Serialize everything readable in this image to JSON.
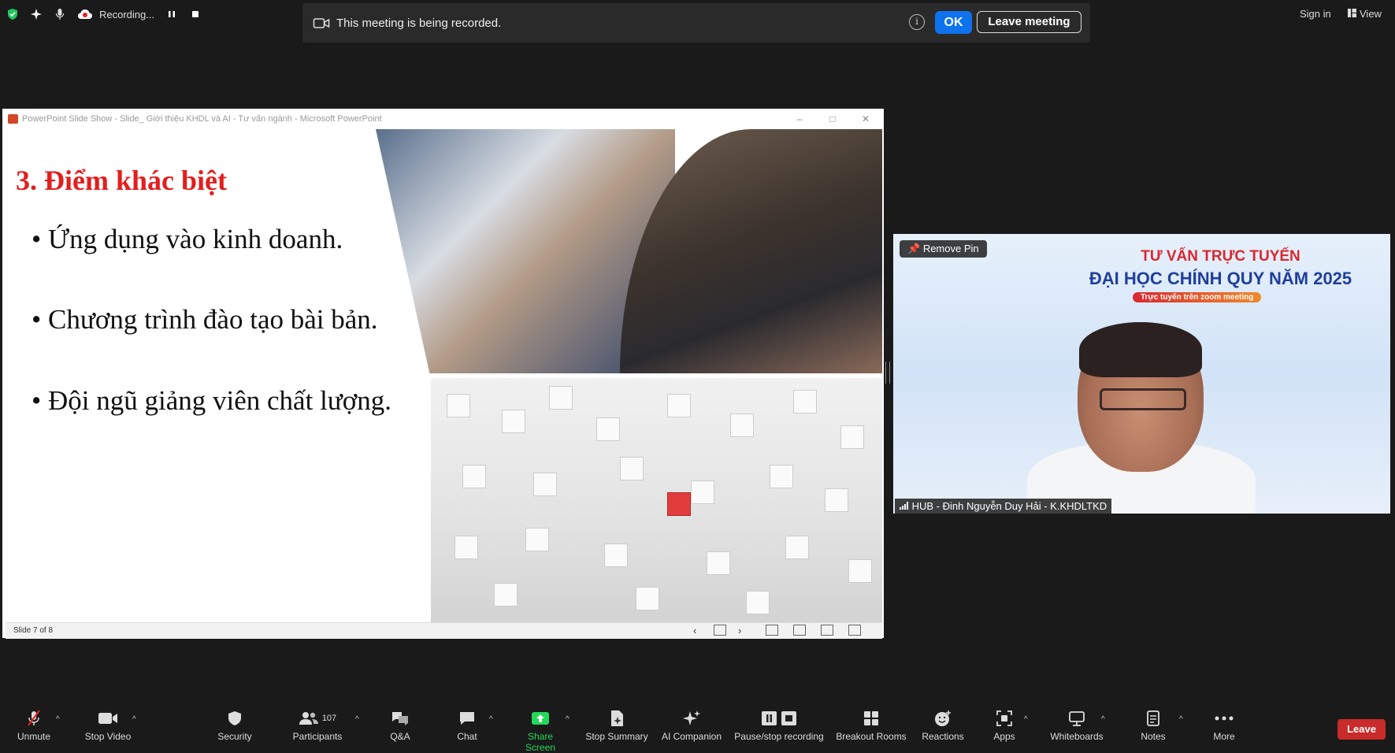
{
  "top_status": {
    "recording_label": "Recording..."
  },
  "banner": {
    "message": "This meeting is being recorded.",
    "ok_label": "OK",
    "leave_label": "Leave meeting"
  },
  "top_right": {
    "signin_label": "Sign in",
    "view_label": "View"
  },
  "ppt": {
    "window_title": "PowerPoint Slide Show  -  Slide_ Giới thiệu KHDL và AI - Tư vấn ngành - Microsoft PowerPoint",
    "slide_title": "3. Điểm khác biệt",
    "bullets": [
      "• Ứng dụng vào kinh doanh.",
      "• Chương trình đào tạo bài bản.",
      "• Đội ngũ giảng viên chất lượng."
    ],
    "status": "Slide 7 of 8"
  },
  "video": {
    "headline1": "TƯ VẤN TRỰC TUYẾN",
    "headline2": "ĐẠI HỌC CHÍNH QUY NĂM 2025",
    "pill_text": "Trực tuyến trên zoom meeting",
    "pin_label": "Remove Pin",
    "participant_name": "HUB - Đinh Nguyễn Duy Hải - K.KHDLTKD"
  },
  "toolbar": {
    "items": [
      {
        "label": "Unmute",
        "icon": "mic-muted-icon"
      },
      {
        "label": "Stop Video",
        "icon": "video-camera-icon"
      },
      {
        "label": "Security",
        "icon": "shield-icon"
      },
      {
        "label": "Participants",
        "icon": "participants-icon",
        "count": "107"
      },
      {
        "label": "Q&A",
        "icon": "qa-icon"
      },
      {
        "label": "Chat",
        "icon": "chat-icon"
      },
      {
        "label": "Share Screen",
        "icon": "share-screen-icon"
      },
      {
        "label": "Stop Summary",
        "icon": "summary-icon"
      },
      {
        "label": "AI Companion",
        "icon": "sparkle-icon"
      },
      {
        "label": "Pause/stop recording",
        "icon": "pause-stop-icon"
      },
      {
        "label": "Breakout Rooms",
        "icon": "breakout-rooms-icon"
      },
      {
        "label": "Reactions",
        "icon": "reactions-icon"
      },
      {
        "label": "Apps",
        "icon": "apps-icon"
      },
      {
        "label": "Whiteboards",
        "icon": "whiteboard-icon"
      },
      {
        "label": "Notes",
        "icon": "notes-icon"
      },
      {
        "label": "More",
        "icon": "more-icon"
      }
    ],
    "leave_label": "Leave"
  },
  "colors": {
    "accent_blue": "#0e72ed",
    "share_green": "#23d959",
    "leave_red": "#c92a2a",
    "slide_title_red": "#e31e1e"
  }
}
